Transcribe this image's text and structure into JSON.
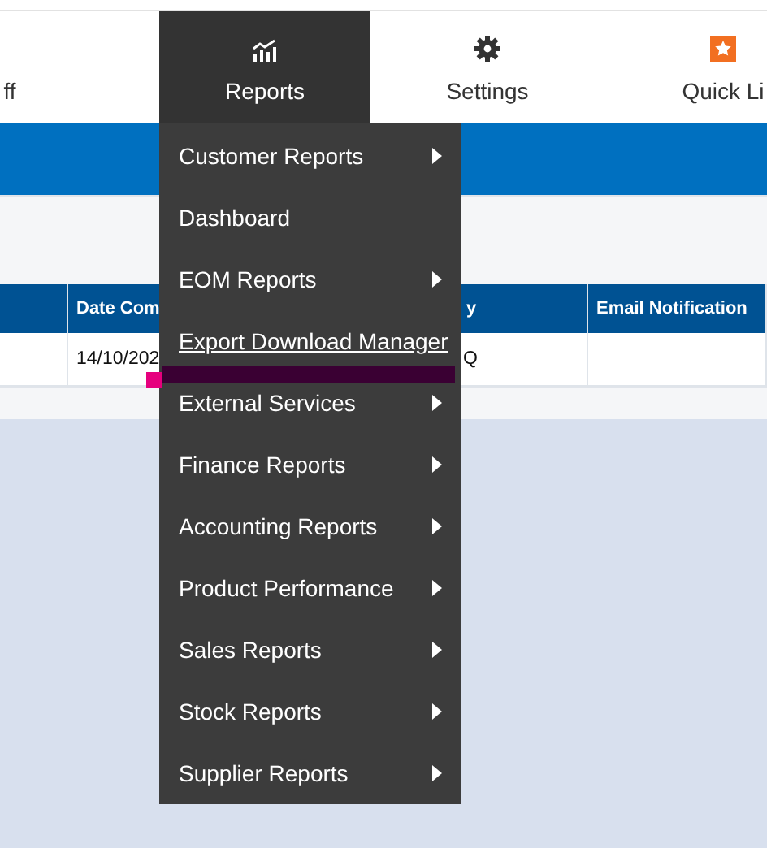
{
  "nav": {
    "items": [
      {
        "label": "ff",
        "kind": "plain",
        "selected": false
      },
      {
        "label": "Reports",
        "kind": "chart",
        "selected": true
      },
      {
        "label": "Settings",
        "kind": "gear",
        "selected": false
      },
      {
        "label": "Quick Li",
        "kind": "star",
        "selected": false
      }
    ]
  },
  "table": {
    "columns": [
      "",
      "Date Com",
      "y",
      "Email Notification"
    ],
    "rows": [
      [
        "",
        "14/10/202",
        "Q",
        ""
      ]
    ]
  },
  "menu": {
    "items": [
      {
        "label": "Customer Reports",
        "submenu": true,
        "hovered": false
      },
      {
        "label": "Dashboard",
        "submenu": false,
        "hovered": false
      },
      {
        "label": "EOM Reports",
        "submenu": true,
        "hovered": false
      },
      {
        "label": "Export Download Manager",
        "submenu": false,
        "hovered": true
      },
      {
        "label": "External Services",
        "submenu": true,
        "hovered": false
      },
      {
        "label": "Finance Reports",
        "submenu": true,
        "hovered": false
      },
      {
        "label": "Accounting Reports",
        "submenu": true,
        "hovered": false
      },
      {
        "label": "Product Performance",
        "submenu": true,
        "hovered": false
      },
      {
        "label": "Sales Reports",
        "submenu": true,
        "hovered": false
      },
      {
        "label": "Stock Reports",
        "submenu": true,
        "hovered": false
      },
      {
        "label": "Supplier Reports",
        "submenu": true,
        "hovered": false
      }
    ]
  }
}
